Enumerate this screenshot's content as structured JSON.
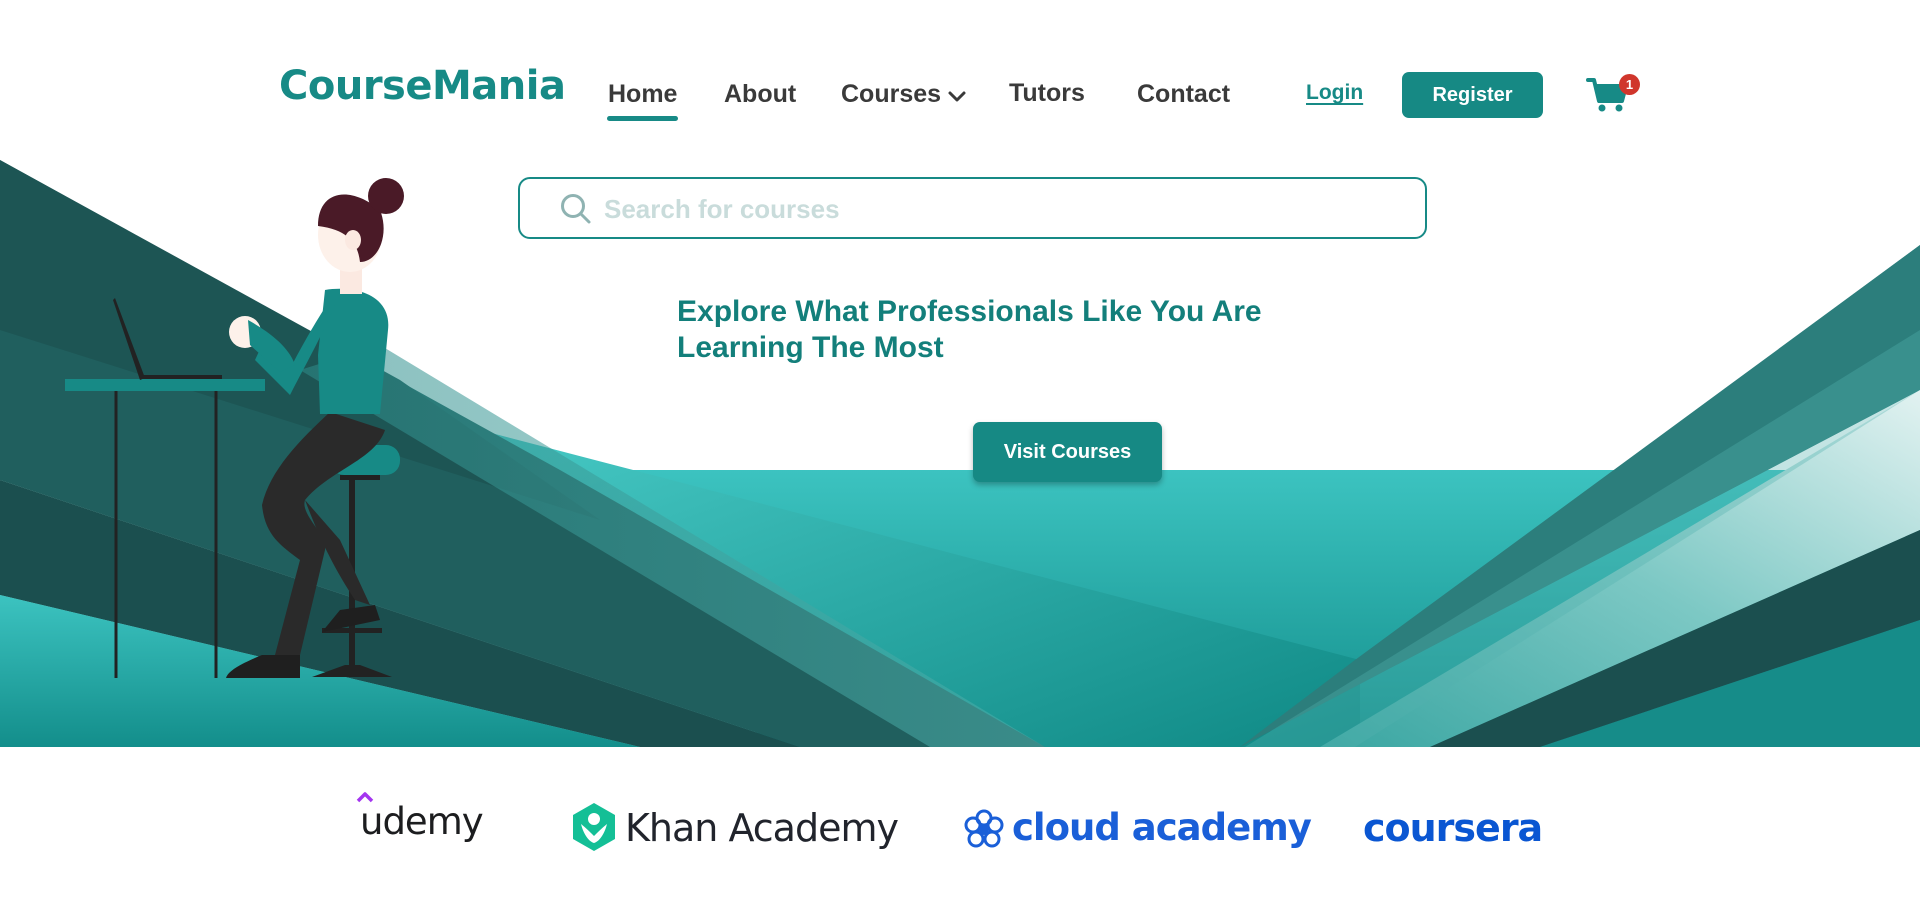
{
  "brand": {
    "name": "CourseMania"
  },
  "nav": {
    "items": [
      {
        "label": "Home",
        "active": true
      },
      {
        "label": "About"
      },
      {
        "label": "Courses",
        "has_dropdown": true
      },
      {
        "label": "Tutors"
      },
      {
        "label": "Contact"
      }
    ],
    "login_label": "Login",
    "register_label": "Register",
    "cart_count": "1"
  },
  "search": {
    "placeholder": "Search for courses",
    "value": ""
  },
  "hero": {
    "headline_line1": "Explore What Professionals Like You Are",
    "headline_line2": "Learning The Most",
    "cta_label": "Visit Courses"
  },
  "partners": [
    {
      "name": "udemy"
    },
    {
      "name": "Khan Academy"
    },
    {
      "name": "cloud academy"
    },
    {
      "name": "coursera"
    }
  ],
  "colors": {
    "brand_teal": "#178a86",
    "button_teal": "#168984",
    "dark_teal": "#1b4f4f",
    "light_teal": "#40c4c1",
    "badge_red": "#d0362c",
    "udemy_purple": "#a435f0",
    "khan_green": "#14bf96",
    "cloud_blue": "#1a5fd8",
    "coursera_blue": "#0a56d2"
  },
  "icons": [
    "chevron-down-icon",
    "search-icon",
    "cart-icon",
    "udemy-logo-icon",
    "khan-academy-logo-icon",
    "cloud-academy-logo-icon"
  ]
}
